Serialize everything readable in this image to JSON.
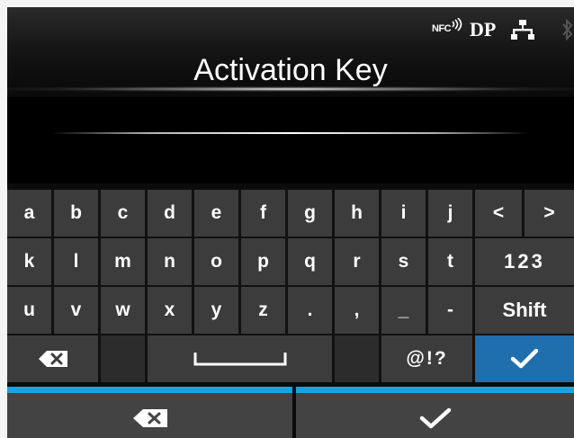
{
  "header": {
    "title": "Activation Key",
    "status": {
      "nfc": "NFC",
      "dp": "DP"
    }
  },
  "input": {
    "value": ""
  },
  "keyboard": {
    "row1": [
      "a",
      "b",
      "c",
      "d",
      "e",
      "f",
      "g",
      "h",
      "i",
      "j",
      "<",
      ">"
    ],
    "row2": [
      "k",
      "l",
      "m",
      "n",
      "o",
      "p",
      "q",
      "r",
      "s",
      "t",
      "123"
    ],
    "row3": [
      "u",
      "v",
      "w",
      "x",
      "y",
      "z",
      ".",
      ",",
      "_",
      "-",
      "Shift"
    ],
    "symbols_label": "@!?"
  },
  "icons": {
    "backspace": "backspace-icon",
    "space": "space-bar-icon",
    "confirm": "checkmark-icon",
    "nfc": "nfc-icon",
    "network": "lan-icon",
    "bluetooth": "bluetooth-icon"
  },
  "colors": {
    "accent_blue": "#1f6fae",
    "bottom_accent": "#16a3e6",
    "key_bg": "#3c3c3c"
  }
}
